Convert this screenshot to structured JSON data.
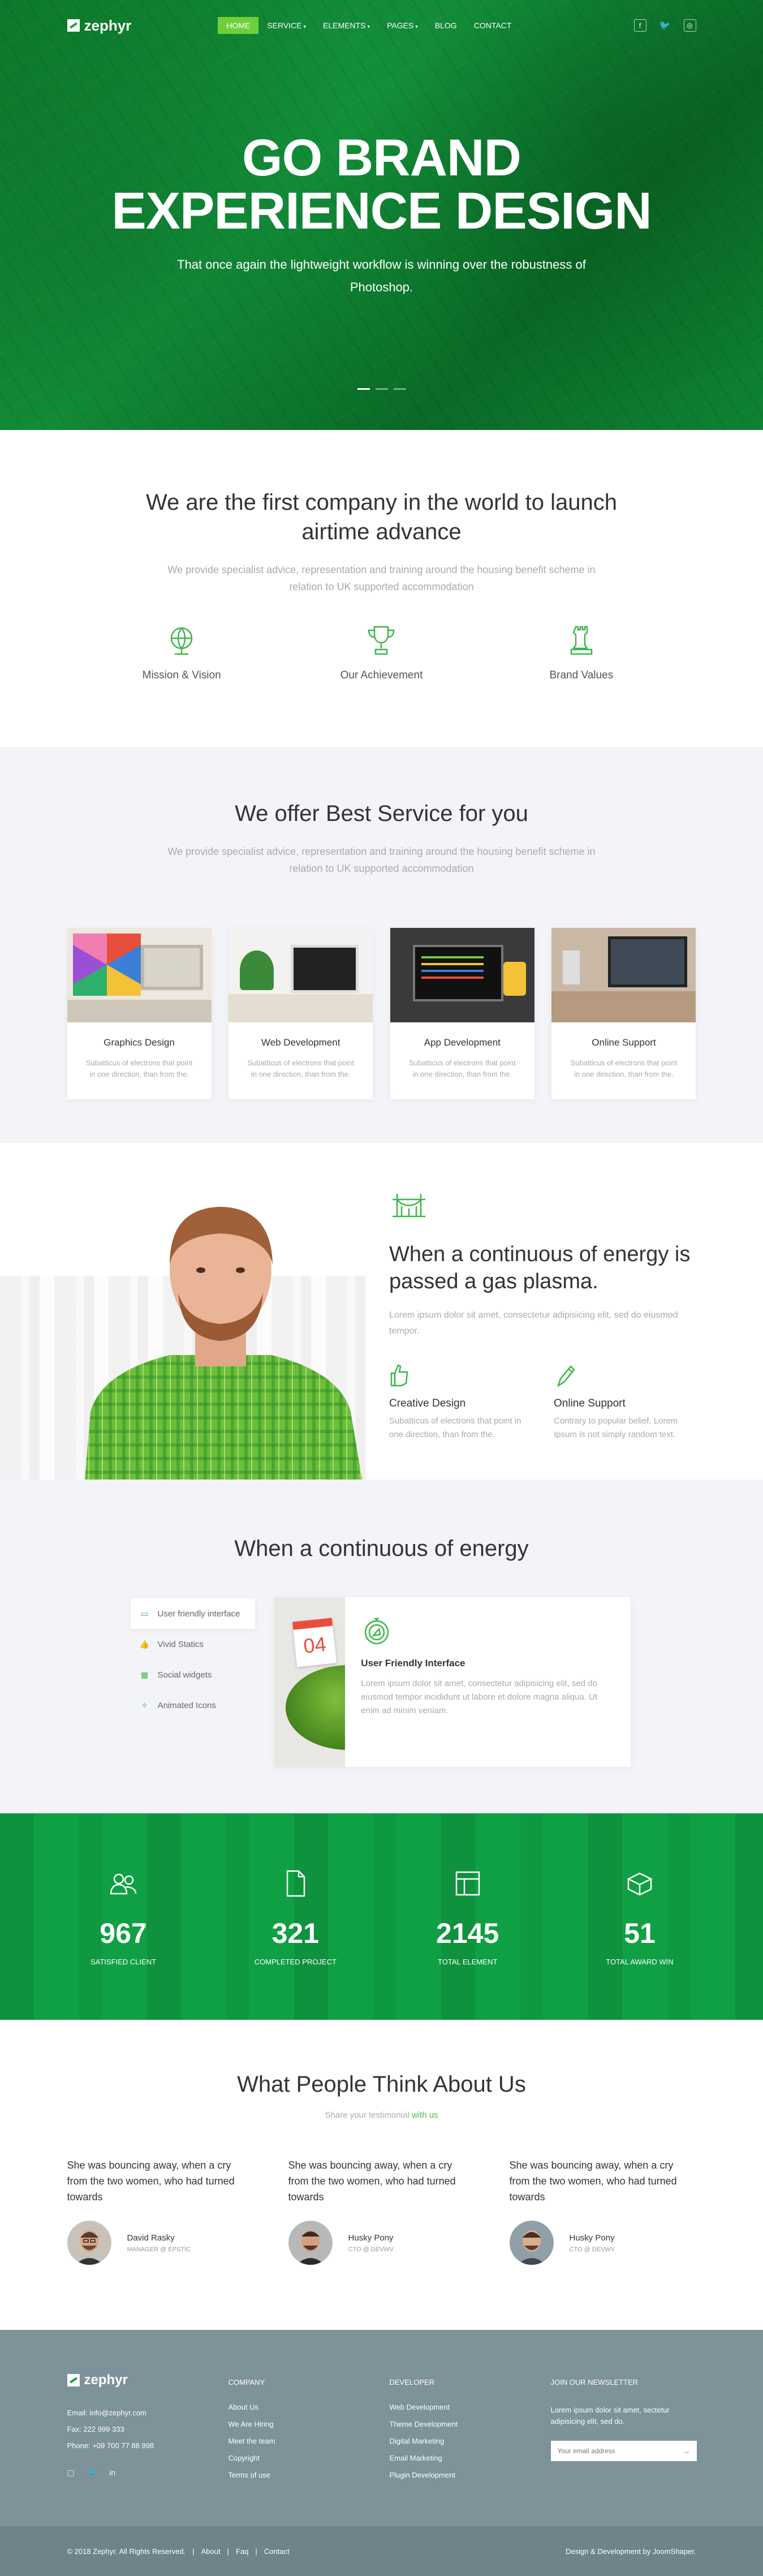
{
  "nav": {
    "logo": "zephyr",
    "items": [
      {
        "label": "HOME",
        "dropdown": false
      },
      {
        "label": "SERVICE",
        "dropdown": true
      },
      {
        "label": "ELEMENTS",
        "dropdown": true
      },
      {
        "label": "PAGES",
        "dropdown": true
      },
      {
        "label": "BLOG",
        "dropdown": false
      },
      {
        "label": "CONTACT",
        "dropdown": false
      }
    ],
    "socials": [
      "facebook-icon",
      "twitter-icon",
      "instagram-icon"
    ]
  },
  "hero": {
    "title_line1": "GO BRAND",
    "title_line2": "EXPERIENCE DESIGN",
    "subtitle": "That once again the lightweight workflow is winning over the robustness of Photoshop.",
    "slides": 3,
    "active_slide": 1
  },
  "intro": {
    "title": "We are the first company in the world to launch airtime advance",
    "text": "We provide specialist advice, representation and training around the housing benefit scheme in relation to UK supported accommodation",
    "features": [
      {
        "label": "Mission & Vision",
        "icon": "globe-icon"
      },
      {
        "label": "Our Achievement",
        "icon": "trophy-icon"
      },
      {
        "label": "Brand Values",
        "icon": "chess-icon"
      }
    ]
  },
  "services": {
    "title": "We offer Best Service for you",
    "text": "We provide specialist advice, representation and training around the housing benefit scheme in relation to UK supported accommodation",
    "cards": [
      {
        "title": "Graphics Design",
        "text": "Subatticus of electrons that point in one direction, than from the."
      },
      {
        "title": "Web Development",
        "text": "Subatticus of electrons that point in one direction, than from the."
      },
      {
        "title": "App Development",
        "text": "Subatticus of electrons that point in one direction, than from the."
      },
      {
        "title": "Online Support",
        "text": "Subatticus of electrons that point in one direction, than from the."
      }
    ]
  },
  "about": {
    "title": "When a continuous of energy is passed a gas plasma.",
    "text": "Lorem ipsum dolor sit amet, consectetur adipisicing elit, sed do eiusmod tempor.",
    "items": [
      {
        "title": "Creative Design",
        "text": "Subatticus of electrons that point in one direction, than from the."
      },
      {
        "title": "Online Support",
        "text": "Contrary to popular belief, Lorem Ipsum is not simply random text."
      }
    ]
  },
  "tabs": {
    "title": "When a continuous of energy",
    "items": [
      {
        "label": "User friendly interface",
        "active": true
      },
      {
        "label": "Vivid Statics",
        "active": false
      },
      {
        "label": "Social widgets",
        "active": false
      },
      {
        "label": "Animated Icons",
        "active": false
      }
    ],
    "panel": {
      "title": "User Friendly Interface",
      "text": "Lorem ipsum dolor sit amet, consectetur adipisicing elit, sed do eiusmod tempor incididunt ut labore et dolore magna aliqua. Ut enim ad minim veniam.",
      "calendar_text": "04"
    }
  },
  "stats": [
    {
      "value": "967",
      "label": "SATISFIED CLIENT",
      "icon": "users-icon"
    },
    {
      "value": "321",
      "label": "COMPLETED PROJECT",
      "icon": "document-icon"
    },
    {
      "value": "2145",
      "label": "TOTAL ELEMENT",
      "icon": "layout-icon"
    },
    {
      "value": "51",
      "label": "TOTAL AWARD WIN",
      "icon": "box-icon"
    }
  ],
  "testimonials": {
    "title": "What People Think About Us",
    "sub_prefix": "Share your testimonial",
    "sub_link": "with us",
    "items": [
      {
        "quote": "She was bouncing away, when a cry from the two women, who had turned towards",
        "name": "David Rasky",
        "role": "MANAGER @ EPSTIC"
      },
      {
        "quote": "She was bouncing away, when a cry from the two women, who had turned towards",
        "name": "Husky Pony",
        "role": "CTO @ DEVWV"
      },
      {
        "quote": "She was bouncing away, when a cry from the two women, who had turned towards",
        "name": "Husky Pony",
        "role": "CTO @ DEVWV"
      }
    ]
  },
  "footer": {
    "logo": "zephyr",
    "email": "Email: info@zephyr.com",
    "fax": "Fax: 222 999 333",
    "phone": "Phone: +09 700 77 88 998",
    "company_title": "COMPANY",
    "company_links": [
      "About Us",
      "We Are Hiring",
      "Meet the team",
      "Copyright",
      "Terms of use"
    ],
    "developer_title": "DEVELOPER",
    "developer_links": [
      "Web Development",
      "Theme Development",
      "Digital Marketing",
      "Email Marketing",
      "Plugin Development"
    ],
    "newsletter_title": "JOIN OUR NEWSLETTER",
    "newsletter_text": "Lorem ipsum dolor sit amet, sectetur adipisicing elit, sed do.",
    "newsletter_placeholder": "Your email address",
    "copyright": "© 2018 Zephyr. All Rights Reserved.",
    "bottom_links": [
      "About",
      "Faq",
      "Contact"
    ],
    "credit": "Design & Development by JoomShaper."
  },
  "colors": {
    "brand_green": "#13913a",
    "accent_green": "#6fcf3b",
    "footer": "#7d9299"
  }
}
